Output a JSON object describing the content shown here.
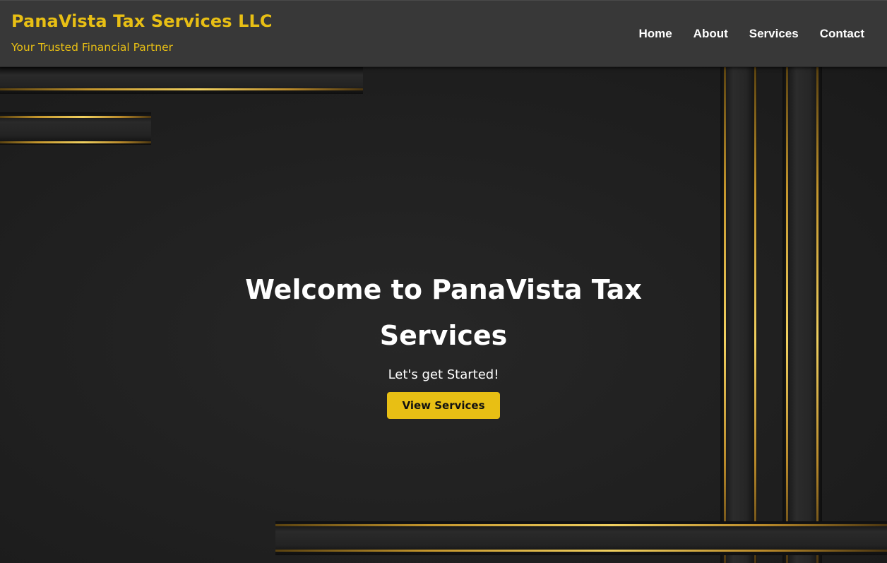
{
  "header": {
    "brand_title": "PanaVista Tax Services LLC",
    "brand_tagline": "Your Trusted Financial Partner",
    "nav": [
      {
        "label": "Home"
      },
      {
        "label": "About"
      },
      {
        "label": "Services"
      },
      {
        "label": "Contact"
      }
    ]
  },
  "hero": {
    "title": "Welcome to PanaVista Tax Services",
    "subtitle": "Let's get Started!",
    "cta_label": "View Services"
  },
  "colors": {
    "accent": "#e8bf14",
    "header_bg": "#383838",
    "hero_bg": "#212121",
    "text": "#ffffff"
  }
}
